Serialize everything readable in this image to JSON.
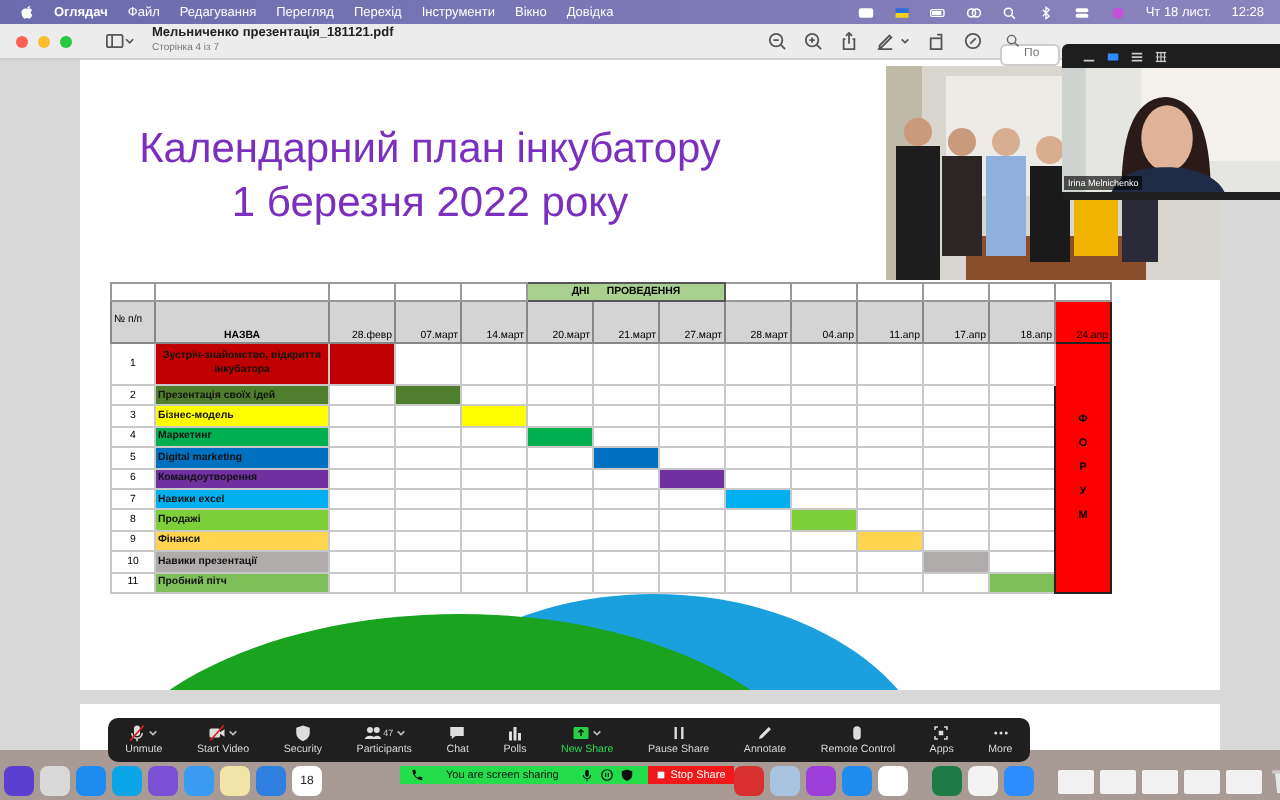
{
  "menubar": {
    "app": "Оглядач",
    "items": [
      "Файл",
      "Редагування",
      "Перегляд",
      "Перехід",
      "Інструменти",
      "Вікно",
      "Довідка"
    ],
    "date": "Чт 18 лист.",
    "time": "12:28"
  },
  "window": {
    "title": "Мельниченко презентація_181121.pdf",
    "subtitle": "Сторінка 4 із 7",
    "search": {
      "placeholder": "По"
    }
  },
  "slide": {
    "title_lines": [
      "Календарний план інкубатору",
      "1 березня 2022 року"
    ],
    "table": {
      "band": "ДНІ      ПРОВЕДЕННЯ",
      "num_header": "№ п/п",
      "name_header": "НАЗВА",
      "columns_before_band": [
        "28.февр",
        "07.март",
        "14.март"
      ],
      "band_columns": [
        "20.март",
        "21.март",
        "27.март"
      ],
      "columns_after_band": [
        "28.март",
        "04.апр",
        "11.апр",
        "17.апр",
        "18.апр"
      ],
      "forum": {
        "label": "24.апр",
        "text": "ФОРУМ"
      },
      "rows": [
        {
          "num": "1",
          "name": "Зустріч-знайомство, відкриття інкубатора",
          "color": "#c00000",
          "filled": [
            true,
            false,
            false,
            false,
            false,
            false,
            false,
            false,
            false,
            false,
            false
          ]
        },
        {
          "num": "2",
          "name": "Презентація своїх ідей",
          "color": "#4f7f2c",
          "filled": [
            false,
            true,
            false,
            false,
            false,
            false,
            false,
            false,
            false,
            false,
            false
          ]
        },
        {
          "num": "3",
          "name": "Бізнес-модель",
          "color": "#ffff00",
          "filled": [
            false,
            false,
            true,
            false,
            false,
            false,
            false,
            false,
            false,
            false,
            false
          ]
        },
        {
          "num": "4",
          "name": "Маркетинг",
          "color": "#00b050",
          "filled": [
            false,
            false,
            false,
            true,
            false,
            false,
            false,
            false,
            false,
            false,
            false
          ]
        },
        {
          "num": "5",
          "name": "Digital marketing",
          "color": "#0070c0",
          "filled": [
            false,
            false,
            false,
            false,
            true,
            false,
            false,
            false,
            false,
            false,
            false
          ]
        },
        {
          "num": "6",
          "name": "Командоутворення",
          "color": "#7030a0",
          "filled": [
            false,
            false,
            false,
            false,
            false,
            true,
            false,
            false,
            false,
            false,
            false
          ]
        },
        {
          "num": "7",
          "name": "Навики excel",
          "color": "#00b0f0",
          "filled": [
            false,
            false,
            false,
            false,
            false,
            false,
            true,
            false,
            false,
            false,
            false
          ]
        },
        {
          "num": "8",
          "name": "Продажі",
          "color": "#7ed03b",
          "filled": [
            false,
            false,
            false,
            false,
            false,
            false,
            false,
            true,
            false,
            false,
            false
          ]
        },
        {
          "num": "9",
          "name": "Фінанси",
          "color": "#ffd54f",
          "filled": [
            false,
            false,
            false,
            false,
            false,
            false,
            false,
            false,
            true,
            false,
            false
          ]
        },
        {
          "num": "10",
          "name": "Навики презентації",
          "color": "#b0acac",
          "filled": [
            false,
            false,
            false,
            false,
            false,
            false,
            false,
            false,
            false,
            true,
            false
          ]
        },
        {
          "num": "11",
          "name": "Пробний пітч",
          "color": "#7fbf5a",
          "filled": [
            false,
            false,
            false,
            false,
            false,
            false,
            false,
            false,
            false,
            false,
            true
          ]
        }
      ]
    }
  },
  "zoom": {
    "self_view": {
      "name": "Irina Melnichenko"
    },
    "toolbar": [
      {
        "label": "Unmute",
        "kind": "mic",
        "off": true,
        "caret": true
      },
      {
        "label": "Start Video",
        "kind": "video",
        "off": true,
        "caret": true
      },
      {
        "label": "Security",
        "kind": "shield",
        "off": false,
        "caret": false
      },
      {
        "label": "Participants",
        "kind": "people",
        "off": false,
        "caret": true,
        "count": "47"
      },
      {
        "label": "Chat",
        "kind": "chat",
        "off": false,
        "caret": false
      },
      {
        "label": "Polls",
        "kind": "polls",
        "off": false,
        "caret": false
      },
      {
        "label": "New Share",
        "kind": "share",
        "off": false,
        "caret": true
      },
      {
        "label": "Pause Share",
        "kind": "pause",
        "off": false,
        "caret": false
      },
      {
        "label": "Annotate",
        "kind": "pencil",
        "off": false,
        "caret": false
      },
      {
        "label": "Remote Control",
        "kind": "mouse",
        "off": false,
        "caret": false
      },
      {
        "label": "Apps",
        "kind": "apps",
        "off": false,
        "caret": false
      },
      {
        "label": "More",
        "kind": "more",
        "off": false,
        "caret": false
      }
    ],
    "sharing": {
      "message": "You are screen sharing",
      "stop": "Stop Share"
    }
  },
  "dock": {
    "calendar_day": "18"
  }
}
